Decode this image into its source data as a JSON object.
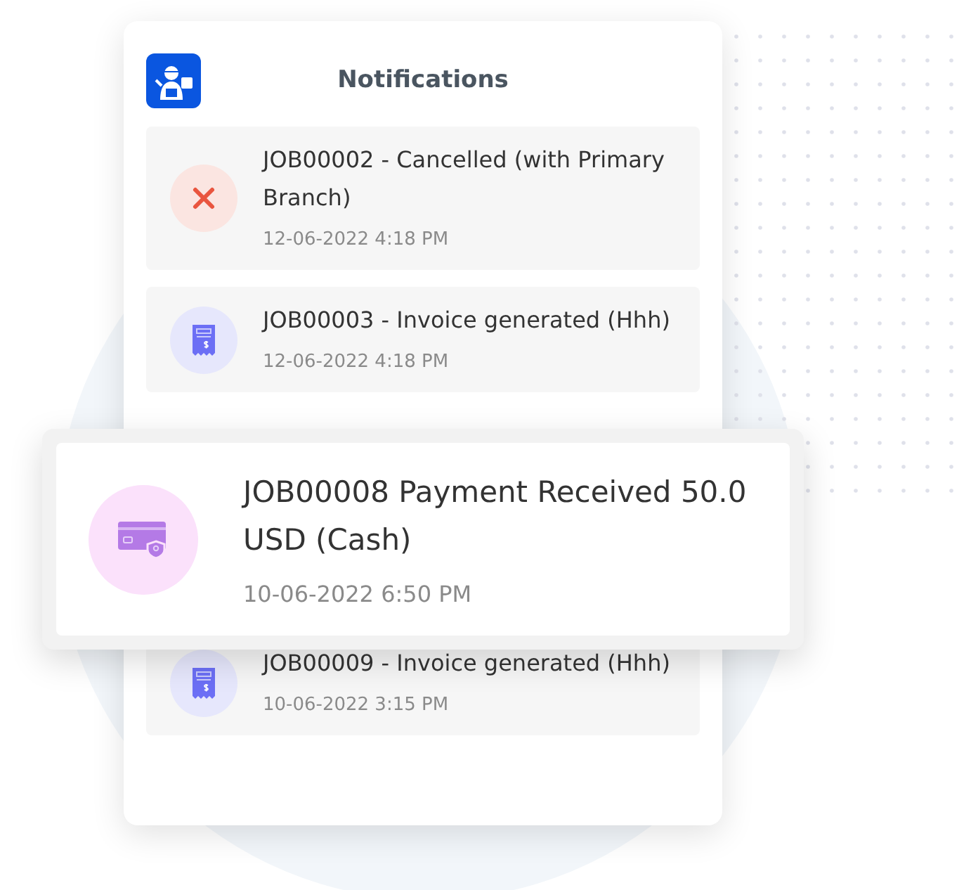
{
  "header": {
    "title": "Notifications"
  },
  "notifications": [
    {
      "kind": "cancelled",
      "title": "JOB00002 - Cancelled (with Primary Branch)",
      "time": "12-06-2022 4:18 PM"
    },
    {
      "kind": "invoice",
      "title": "JOB00003 - Invoice generated (Hhh)",
      "time": "12-06-2022 4:18 PM"
    },
    {
      "kind": "invoice",
      "title": "JOB00009 - Invoice generated (Hhh)",
      "time": "10-06-2022 3:15 PM"
    }
  ],
  "highlight": {
    "kind": "payment",
    "title": "JOB00008 Payment Received 50.0 USD (Cash)",
    "time": "10-06-2022 6:50 PM"
  }
}
